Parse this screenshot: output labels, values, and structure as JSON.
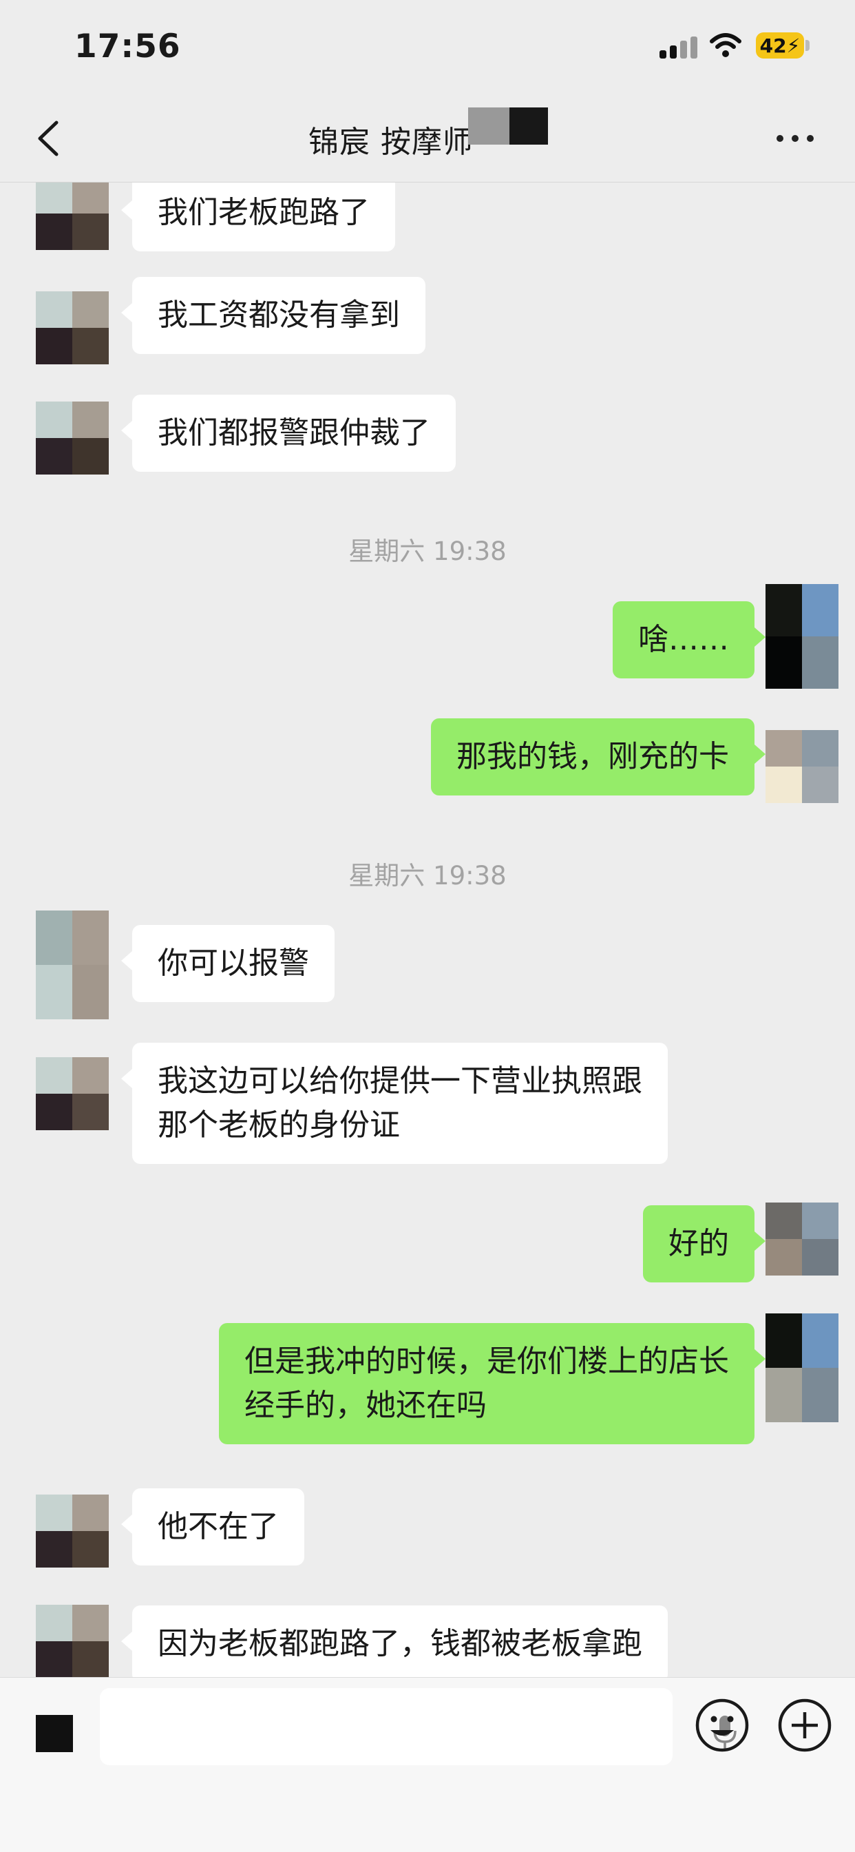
{
  "status_bar": {
    "time": "17:56",
    "battery": "42",
    "icons": [
      "cellular-signal-icon",
      "wifi-icon",
      "battery-charging-icon"
    ]
  },
  "nav": {
    "title": "锦宸 按摩师",
    "back_icon": "chevron-left-icon",
    "more_icon": "ellipsis-icon"
  },
  "messages": [
    {
      "side": "in",
      "text": "我们老板跑路了"
    },
    {
      "side": "in",
      "text": "我工资都没有拿到"
    },
    {
      "side": "in",
      "text": "我们都报警跟仲裁了"
    },
    {
      "timestamp": "星期六 19:38"
    },
    {
      "side": "out",
      "text": "啥……"
    },
    {
      "side": "out",
      "text": "那我的钱，刚充的卡"
    },
    {
      "timestamp": "星期六 19:38"
    },
    {
      "side": "in",
      "text": "你可以报警"
    },
    {
      "side": "in",
      "lines": [
        "我这边可以给你提供一下营业执照跟",
        "那个老板的身份证"
      ]
    },
    {
      "side": "out",
      "text": "好的"
    },
    {
      "side": "out",
      "lines": [
        "但是我冲的时候，是你们楼上的店长",
        "经手的，她还在吗"
      ]
    },
    {
      "side": "in",
      "text": "他不在了"
    },
    {
      "side": "in",
      "text": "因为老板都跑路了，钱都被老板拿跑"
    }
  ],
  "input_bar": {
    "icons": [
      "voice-toggle-icon",
      "microphone-icon",
      "emoji-icon",
      "plus-icon"
    ]
  },
  "colors": {
    "background": "#ededed",
    "outgoing_bubble": "#95ec69",
    "incoming_bubble": "#ffffff",
    "timestamp_text": "#a3a3a3",
    "battery": "#f5c518"
  }
}
